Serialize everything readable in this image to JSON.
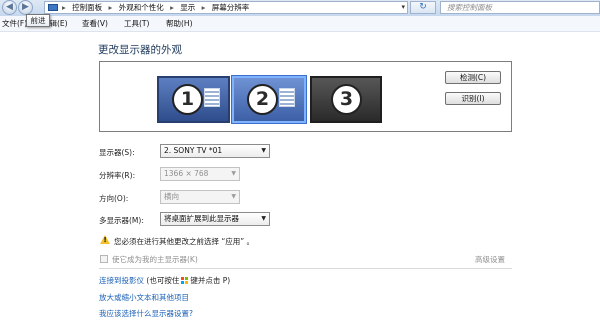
{
  "nav": {
    "back_glyph": "◀",
    "forward_glyph": "▶"
  },
  "tooltip": "前进",
  "address": {
    "icon": "control-panel-icon",
    "crumbs": [
      "控制面板",
      "外观和个性化",
      "显示",
      "屏幕分辨率"
    ],
    "separator": "▸",
    "dropdown_glyph": "▾",
    "refresh_glyph": "↻",
    "search_placeholder": "搜索控制面板"
  },
  "menu": [
    "文件(F)",
    "编辑(E)",
    "查看(V)",
    "工具(T)",
    "帮助(H)"
  ],
  "page_title": "更改显示器的外观",
  "monitors": [
    {
      "number": "1",
      "color": "#3a5a9c"
    },
    {
      "number": "2",
      "color": "#4b72bf",
      "selected": true
    },
    {
      "number": "3",
      "color": "#3a3a3a"
    }
  ],
  "buttons": {
    "detect": "检测(C)",
    "identify": "识别(I)"
  },
  "settings": {
    "display_label": "显示器(S):",
    "display_value": "2. SONY TV  *01",
    "resolution_label": "分辨率(R):",
    "resolution_value": "1366 × 768",
    "orientation_label": "方向(O):",
    "orientation_value": "横向",
    "multi_label": "多显示器(M):",
    "multi_value": "将桌面扩展到此显示器",
    "dropdown_glyph": "▼"
  },
  "warning": {
    "icon": "warning-icon",
    "text": "您必须在进行其他更改之前选择 “应用” 。",
    "color": "#f1c22c"
  },
  "main_display_checkbox": "使它成为我的主显示器(K)",
  "advanced_link": "高级设置",
  "links": {
    "projector_link": "连接到投影仪",
    "projector_rest_before": "(也可按住",
    "projector_rest_after": "键并点击 P)",
    "text_size": "放大或缩小文本和其他项目",
    "which_settings": "我应该选择什么显示器设置?"
  },
  "colors": {
    "link": "#1d62b8",
    "title": "#1e395b"
  }
}
